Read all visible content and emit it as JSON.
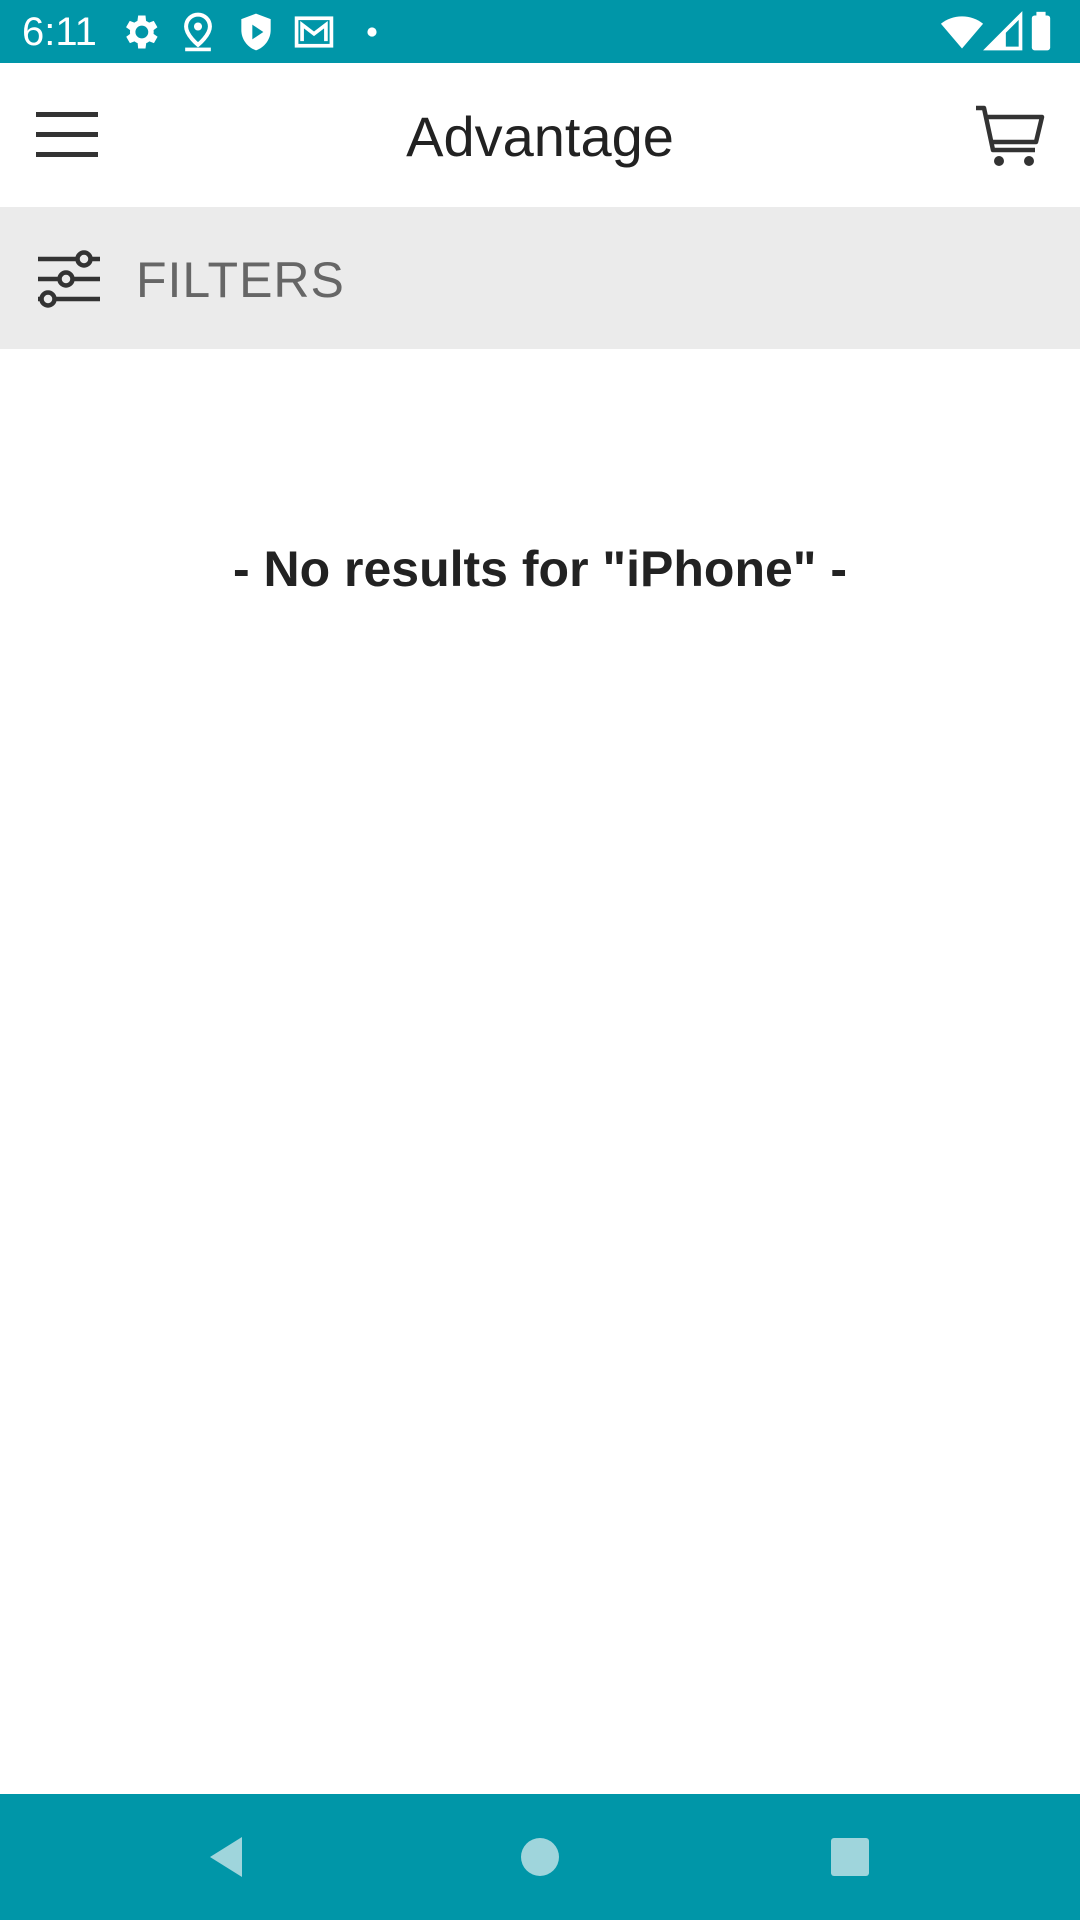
{
  "status_bar": {
    "time": "6:11",
    "background": "#0096A8",
    "left_icons": [
      "gear-icon",
      "location-pin-icon",
      "shield-play-icon",
      "gmail-icon",
      "dot-icon"
    ],
    "right_icons": [
      "wifi-icon",
      "signal-icon",
      "battery-icon"
    ]
  },
  "app_bar": {
    "title": "Advantage",
    "menu_icon": "hamburger-menu-icon",
    "cart_icon": "shopping-cart-icon"
  },
  "filters": {
    "label": "FILTERS",
    "icon": "sliders-icon"
  },
  "content": {
    "no_results_message": "- No results for \"iPhone\" -"
  },
  "nav_bar": {
    "background": "#0096A8",
    "buttons": [
      "back-icon",
      "home-icon",
      "recents-icon"
    ]
  }
}
